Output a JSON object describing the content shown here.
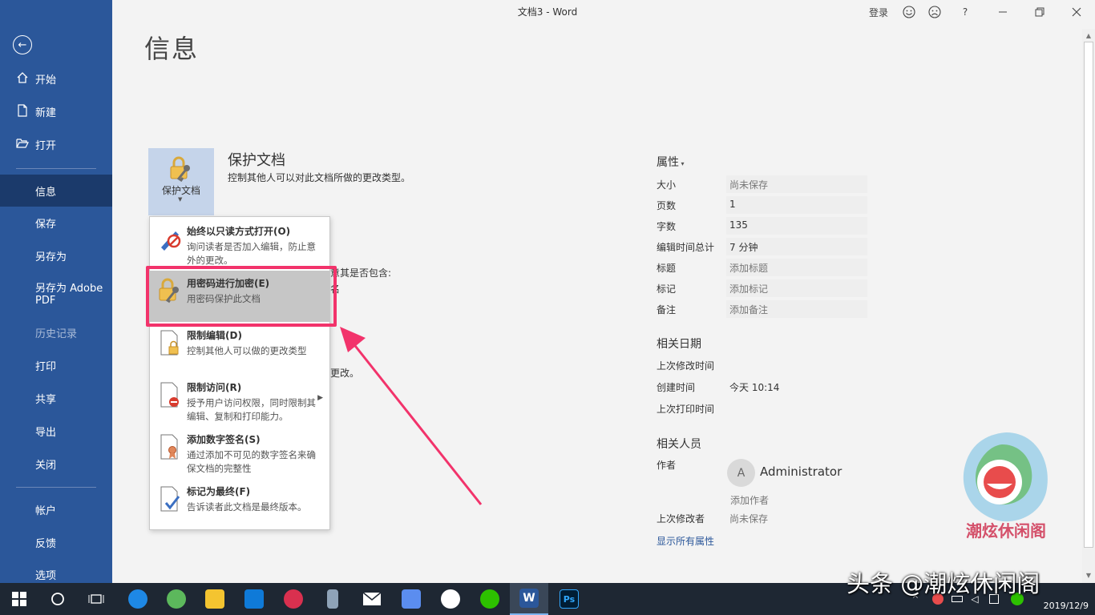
{
  "window": {
    "title": "文档3  -  Word"
  },
  "titlebar": {
    "signin": "登录",
    "help": "?"
  },
  "sidebar": {
    "items": [
      {
        "label": "开始"
      },
      {
        "label": "新建"
      },
      {
        "label": "打开"
      },
      {
        "label": "信息"
      },
      {
        "label": "保存"
      },
      {
        "label": "另存为"
      },
      {
        "label": "另存为 Adobe PDF"
      },
      {
        "label": "历史记录"
      },
      {
        "label": "打印"
      },
      {
        "label": "共享"
      },
      {
        "label": "导出"
      },
      {
        "label": "关闭"
      },
      {
        "label": "帐户"
      },
      {
        "label": "反馈"
      },
      {
        "label": "选项"
      }
    ]
  },
  "main": {
    "title": "信息",
    "protect": {
      "button_label": "保护文档",
      "title": "保护文档",
      "description": "控制其他人可以对此文档所做的更改类型。"
    },
    "background_fragments": [
      "意其是否包含:",
      "名",
      "更改。"
    ]
  },
  "menu": {
    "items": [
      {
        "title": "始终以只读方式打开(O)",
        "desc": "询问读者是否加入编辑，防止意外的更改。"
      },
      {
        "title": "用密码进行加密(E)",
        "desc": "用密码保护此文档"
      },
      {
        "title": "限制编辑(D)",
        "desc": "控制其他人可以做的更改类型"
      },
      {
        "title": "限制访问(R)",
        "desc": "授予用户访问权限，同时限制其编辑、复制和打印能力。"
      },
      {
        "title": "添加数字签名(S)",
        "desc": "通过添加不可见的数字签名来确保文档的完整性"
      },
      {
        "title": "标记为最终(F)",
        "desc": "告诉读者此文档是最终版本。"
      }
    ]
  },
  "properties": {
    "heading": "属性",
    "rows": [
      {
        "key": "大小",
        "value": "尚未保存"
      },
      {
        "key": "页数",
        "value": "1"
      },
      {
        "key": "字数",
        "value": "135"
      },
      {
        "key": "编辑时间总计",
        "value": "7 分钟"
      },
      {
        "key": "标题",
        "value": "添加标题"
      },
      {
        "key": "标记",
        "value": "添加标记"
      },
      {
        "key": "备注",
        "value": "添加备注"
      }
    ]
  },
  "related_dates": {
    "heading": "相关日期",
    "rows": [
      {
        "key": "上次修改时间",
        "value": ""
      },
      {
        "key": "创建时间",
        "value": "今天 10:14"
      },
      {
        "key": "上次打印时间",
        "value": ""
      }
    ]
  },
  "related_people": {
    "heading": "相关人员",
    "author_label": "作者",
    "author_initial": "A",
    "author_name": "Administrator",
    "add_author": "添加作者",
    "last_modified_by_label": "上次修改者",
    "last_modified_by": "尚未保存"
  },
  "show_all": "显示所有属性",
  "watermark": {
    "text": "头条 @潮炫休闲阁",
    "logo_text": "潮炫休闲阁"
  },
  "taskbar": {
    "date": "2019/12/9"
  },
  "colors": {
    "accent": "#2b579a",
    "highlight": "#f2336b"
  }
}
